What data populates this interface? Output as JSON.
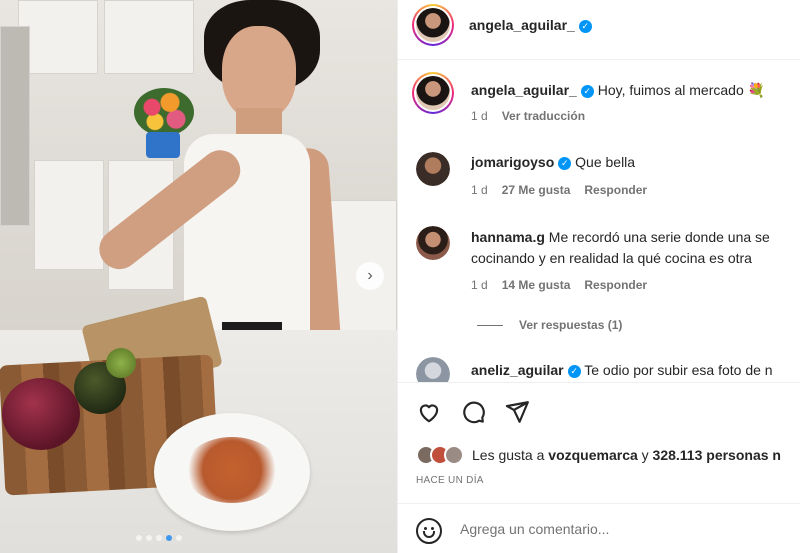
{
  "header": {
    "username": "angela_aguilar_"
  },
  "caption": {
    "username": "angela_aguilar_",
    "text": "Hoy, fuimos al mercado 💐",
    "time": "1 d",
    "translate": "Ver traducción"
  },
  "comments": [
    {
      "username": "jomarigoyso",
      "verified": true,
      "text": "Que bella",
      "time": "1 d",
      "likes": "27 Me gusta",
      "reply": "Responder"
    },
    {
      "username": "hannama.g",
      "verified": false,
      "text_line1": "Me recordó una serie donde una se",
      "text_line2": "cocinando y en realidad la qué cocina es otra",
      "time": "1 d",
      "likes": "14 Me gusta",
      "reply": "Responder",
      "view_replies": "Ver respuestas (1)"
    },
    {
      "username": "aneliz_aguilar",
      "verified": true,
      "text": "Te odio por subir esa foto de n"
    }
  ],
  "post": {
    "likes_prefix": "Les gusta a",
    "likes_user": "vozquemarca",
    "likes_mid": "y",
    "likes_count": "328.113 personas n",
    "time_ago": "HACE UN DÍA",
    "comment_placeholder": "Agrega un comentario..."
  },
  "carousel": {
    "slide_count": 5,
    "active_index": 3
  },
  "icons": {
    "verified": "verified-badge-icon",
    "like": "heart-icon",
    "comment": "comment-icon",
    "share": "send-icon",
    "emoji": "emoji-icon",
    "next": "chevron-right-icon"
  },
  "colors": {
    "verified": "#0095f6",
    "text": "#262626",
    "muted": "#737373",
    "active_dot": "#3f97f0"
  }
}
